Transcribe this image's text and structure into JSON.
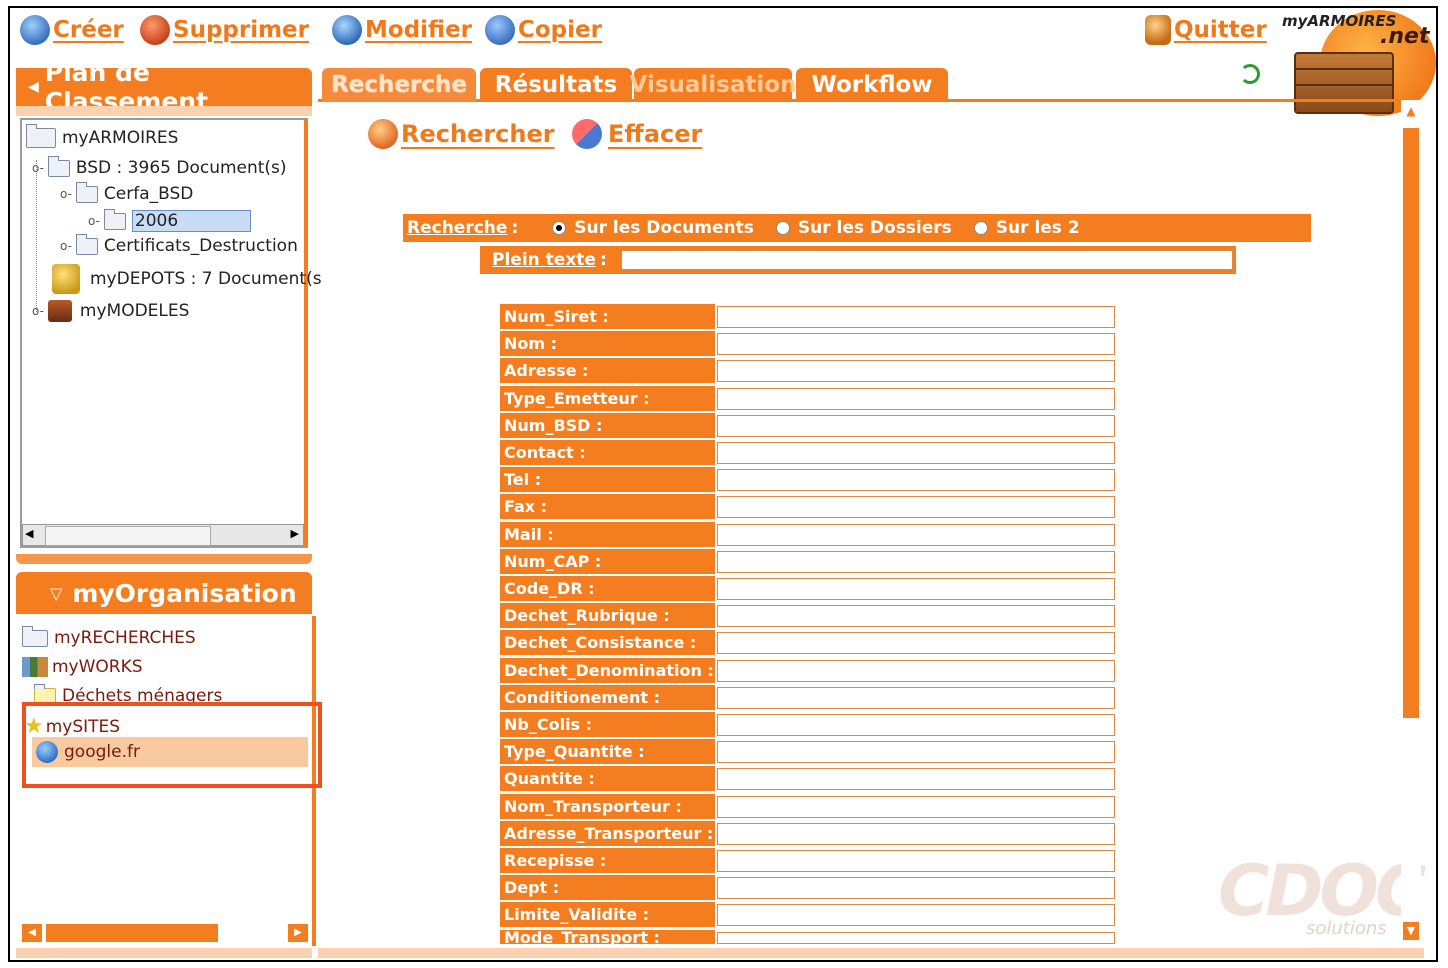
{
  "toolbar": {
    "create": "Créer",
    "delete": "Supprimer",
    "modify": "Modifier",
    "copy": "Copier",
    "quit": "Quitter"
  },
  "logo": {
    "brand": "myARMOIRES",
    "suffix": ".net"
  },
  "plan": {
    "title": "Plan de Classement",
    "tree": [
      {
        "label": "myARMOIRES"
      },
      {
        "label": "BSD : 3965 Document(s)"
      },
      {
        "label": "Cerfa_BSD"
      },
      {
        "label": "2006"
      },
      {
        "label": "Certificats_Destruction"
      },
      {
        "label": "myDEPOTS : 7 Document(s"
      },
      {
        "label": "myMODELES"
      }
    ]
  },
  "org": {
    "title": "myOrganisation",
    "items": [
      {
        "label": "myRECHERCHES"
      },
      {
        "label": "myWORKS"
      },
      {
        "label": "Déchets ménagers"
      },
      {
        "label": "mySITES"
      },
      {
        "label": "google.fr"
      }
    ]
  },
  "tabs": [
    "Recherche",
    "Résultats",
    "Visualisation",
    "Workflow"
  ],
  "actions": {
    "search": "Rechercher",
    "clear": "Effacer"
  },
  "search": {
    "label": "Recherche",
    "options": [
      "Sur les Documents",
      "Sur les Dossiers",
      "Sur les 2"
    ],
    "selected": "Sur les Documents",
    "fulltext_label": "Plein texte",
    "fulltext_value": ""
  },
  "fields": [
    "Num_Siret :",
    "Nom :",
    "Adresse :",
    "Type_Emetteur :",
    "Num_BSD :",
    "Contact :",
    "Tel :",
    "Fax :",
    "Mail :",
    "Num_CAP :",
    "Code_DR :",
    "Dechet_Rubrique :",
    "Dechet_Consistance :",
    "Dechet_Denomination :",
    "Conditionement :",
    "Nb_Colis :",
    "Type_Quantite :",
    "Quantite :",
    "Nom_Transporteur :",
    "Adresse_Transporteur :",
    "Recepisse :",
    "Dept :",
    "Limite_Validite :",
    "Mode_Transport :"
  ],
  "watermark": {
    "brand": "CDOC",
    "sub": "solutions"
  },
  "colors": {
    "accent": "#f47d20",
    "highlight": "#f0501e",
    "link": "#f07a1a"
  }
}
